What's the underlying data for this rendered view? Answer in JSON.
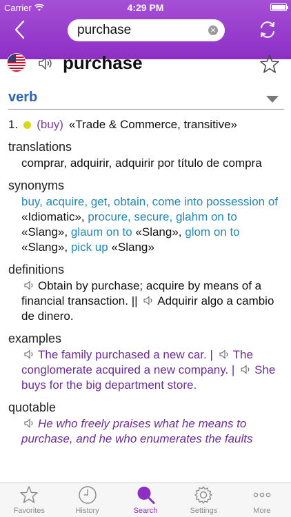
{
  "status": {
    "carrier": "Carrier",
    "time": "4:29 PM"
  },
  "search": {
    "value": "purchase",
    "clear_glyph": "×"
  },
  "entry": {
    "headword": "purchase",
    "pos": "verb",
    "sense_number": "1.",
    "sense_paren": "(buy)",
    "sense_domain": "«Trade & Commerce, transitive»"
  },
  "sections": {
    "translations_label": "translations",
    "translations_text": "comprar, adquirir, adquirir por título de compra",
    "synonyms_label": "synonyms",
    "syn_1": "buy, acquire, get, obtain, come into possession of",
    "syn_1_tag": " «Idiomatic», ",
    "syn_2": "procure, secure, glahm on to",
    "syn_2_tag": " «Slang», ",
    "syn_3": "glaum on to",
    "syn_3_tag": " «Slang», ",
    "syn_4": "glom on to",
    "syn_4_tag": " «Slang», ",
    "syn_5": "pick up",
    "syn_5_tag": " «Slang»",
    "definitions_label": "definitions",
    "def_en": "Obtain by purchase; acquire by means of a financial transaction. ||",
    "def_es": "Adquirir algo a cambio de dinero.",
    "examples_label": "examples",
    "ex_1": "The family purchased a new car. |",
    "ex_2": "The conglomerate acquired a new company. |",
    "ex_3": "She buys for the big department store.",
    "quotable_label": "quotable",
    "quote_text": "He who freely praises what he means to purchase, and he who enumerates the faults"
  },
  "tabs": [
    {
      "label": "Favorites",
      "icon": "star-icon"
    },
    {
      "label": "History",
      "icon": "clock-icon"
    },
    {
      "label": "Search",
      "icon": "search-icon"
    },
    {
      "label": "Settings",
      "icon": "gear-icon"
    },
    {
      "label": "More",
      "icon": "more-icon"
    }
  ],
  "colors": {
    "accent": "#8d2fc4",
    "link_blue": "#2486b4",
    "pos_blue": "#2a66b3",
    "example_purple": "#6b2d93",
    "sense_dot": "#d8d61c"
  }
}
